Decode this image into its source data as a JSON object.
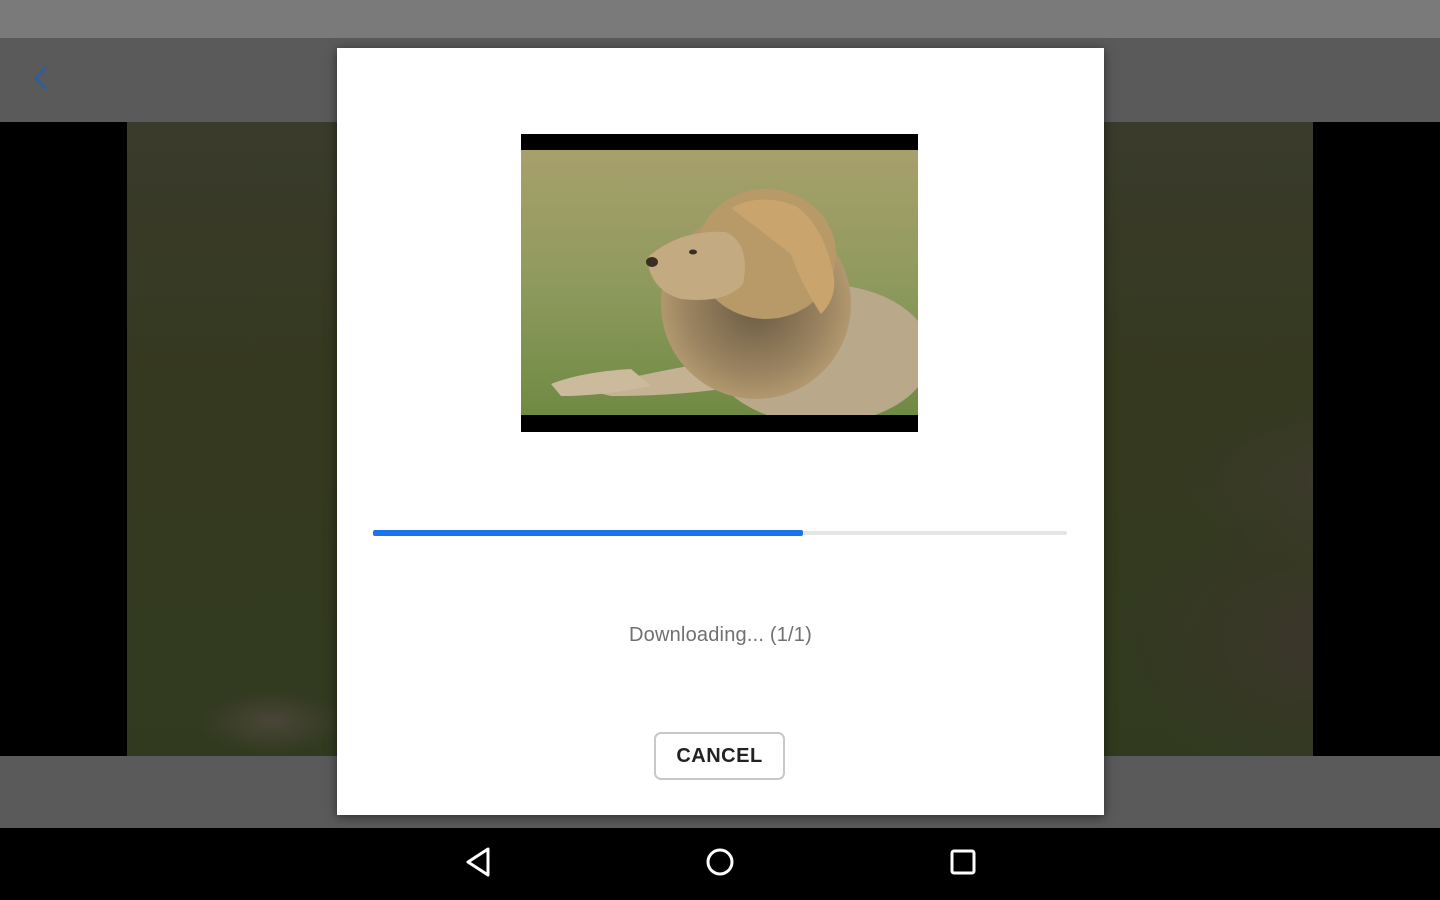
{
  "dialog": {
    "status_text": "Downloading... (1/1)",
    "cancel_label": "CANCEL",
    "progress_fraction": 0.62
  },
  "colors": {
    "progress_accent": "#1a73e8",
    "back_icon": "#2f5f96"
  },
  "icons": {
    "app_bar": [
      "back-arrow-icon"
    ],
    "nav_bar": [
      "nav-back-icon",
      "nav-home-icon",
      "nav-recents-icon"
    ]
  }
}
